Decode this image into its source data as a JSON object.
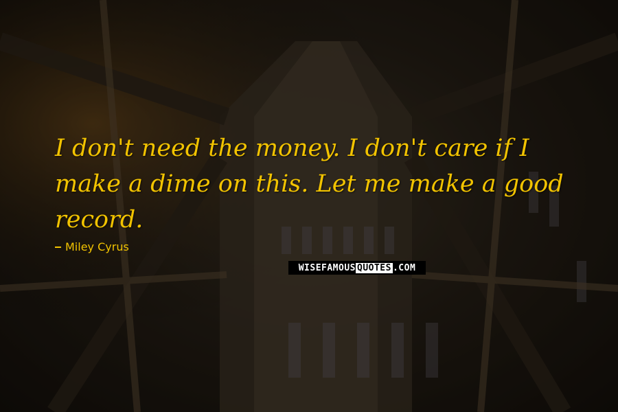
{
  "quote": {
    "text": "I don't need the money. I don't care if I make a dime on this. Let me make a good record.",
    "author": "Miley Cyrus"
  },
  "watermark": {
    "part1": "WISEFAMOUS",
    "part2": "QUOTES",
    "part3": ".COM"
  },
  "colors": {
    "text": "#f2c300",
    "background": "#221c14"
  }
}
